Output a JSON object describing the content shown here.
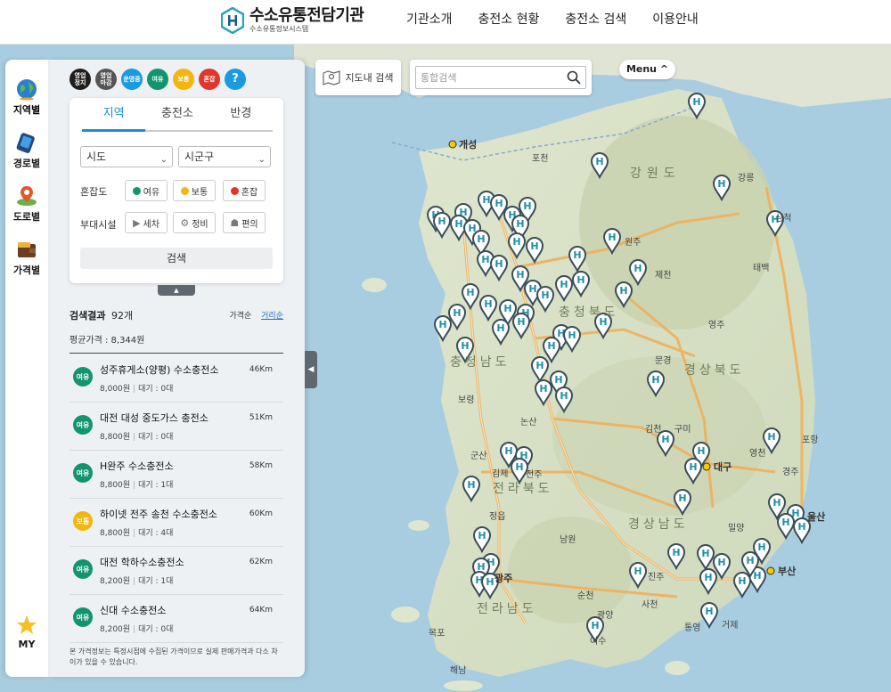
{
  "header": {
    "logo_title": "수소유통전담기관",
    "logo_subtitle": "수소유통정보시스템",
    "nav": [
      "기관소개",
      "충전소 현황",
      "충전소 검색",
      "이용안내"
    ]
  },
  "rail": [
    {
      "label": "지역별",
      "icon": "globe-icon"
    },
    {
      "label": "경로별",
      "icon": "route-device-icon"
    },
    {
      "label": "도로별",
      "icon": "road-pin-icon"
    },
    {
      "label": "가격별",
      "icon": "wallet-icon"
    },
    {
      "label": "MY",
      "icon": "star-icon"
    }
  ],
  "status_chips": [
    {
      "label": "영업\n정지",
      "color": "#1e1e1e"
    },
    {
      "label": "영업\n마감",
      "color": "#555555"
    },
    {
      "label": "운영중",
      "color": "#1a9ae0"
    },
    {
      "label": "여유",
      "color": "#12946e"
    },
    {
      "label": "보통",
      "color": "#f2b60f"
    },
    {
      "label": "혼잡",
      "color": "#e0352b"
    },
    {
      "label": "?",
      "color": "#1a9ae0"
    }
  ],
  "filter": {
    "tabs": [
      "지역",
      "충전소",
      "반경"
    ],
    "active_tab": "지역",
    "sido": "시도",
    "sigungu": "시군구",
    "congestion_label": "혼잡도",
    "congestion": [
      {
        "label": "여유",
        "color": "#12946e"
      },
      {
        "label": "보통",
        "color": "#f2b60f"
      },
      {
        "label": "혼잡",
        "color": "#e0352b"
      }
    ],
    "facility_label": "부대시설",
    "facilities": [
      {
        "label": "세차",
        "icon": "car-wash-icon"
      },
      {
        "label": "정비",
        "icon": "wrench-icon"
      },
      {
        "label": "편의",
        "icon": "store-icon"
      }
    ],
    "search_label": "검색"
  },
  "results": {
    "title": "검색결과",
    "count": "92개",
    "sort": [
      "가격순",
      "거리순"
    ],
    "active_sort": "거리순",
    "avg_price": "평균가격 : 8,344원",
    "items": [
      {
        "badge": "여유",
        "status": "green",
        "name": "성주휴게소(양평) 수소충전소",
        "distance": "46Km",
        "price": "8,000원",
        "wait": "대기 : 0대"
      },
      {
        "badge": "여유",
        "status": "green",
        "name": "대전 대성 중도가스 충전소",
        "distance": "51Km",
        "price": "8,800원",
        "wait": "대기 : 0대"
      },
      {
        "badge": "여유",
        "status": "green",
        "name": "H완주 수소충전소",
        "distance": "58Km",
        "price": "8,800원",
        "wait": "대기 : 1대"
      },
      {
        "badge": "보통",
        "status": "yellow",
        "name": "하이넷 전주 송천 수소충전소",
        "distance": "60Km",
        "price": "8,800원",
        "wait": "대기 : 4대"
      },
      {
        "badge": "여유",
        "status": "green",
        "name": "대전 학하수소충전소",
        "distance": "62Km",
        "price": "8,200원",
        "wait": "대기 : 1대"
      },
      {
        "badge": "여유",
        "status": "green",
        "name": "신대 수소충전소",
        "distance": "64Km",
        "price": "8,200원",
        "wait": "대기 : 0대"
      }
    ],
    "notice": "본 가격정보는 특정시점에 수집된 가격이므로 실제 판매가격과 다소 차이가 있을 수 있습니다."
  },
  "map": {
    "search_button": "지도내 검색",
    "search_placeholder": "통합검색",
    "menu_button": "Menu ^",
    "labels": {
      "gaeseong": "개성",
      "pocheon": "포천",
      "gangwondo": "강원도",
      "gangneung": "강릉",
      "wonju": "원주",
      "jecheon": "제천",
      "taebaek": "태백",
      "yeongju": "영주",
      "chungbuk": "충청북도",
      "chungnam": "충청남도",
      "gyeongbuk": "경상북도",
      "mungyeong": "문경",
      "boryeong": "보령",
      "nonsan": "논산",
      "gimcheon": "김천",
      "gumi": "구미",
      "daegu": "대구",
      "gyeongju": "경주",
      "pohang": "포항",
      "yeongcheon": "영천",
      "ulsan": "울산",
      "busan": "부산",
      "miryang": "밀양",
      "gyeongnam": "경상남도",
      "jinju": "진주",
      "sacheon": "사천",
      "tongyeong": "통영",
      "geoje": "거제",
      "jeonbuk": "전라북도",
      "jeongeup": "정읍",
      "namwon": "남원",
      "gimje": "김제",
      "gunsan": "군산",
      "jeonnam": "전라남도",
      "gwangju": "광주",
      "yeosu": "여수",
      "gwangyang": "광양",
      "suncheon": "순천",
      "mokpo": "목포",
      "haenam": "해남",
      "jeonju": "전주",
      "samcheok": "삼척"
    }
  }
}
